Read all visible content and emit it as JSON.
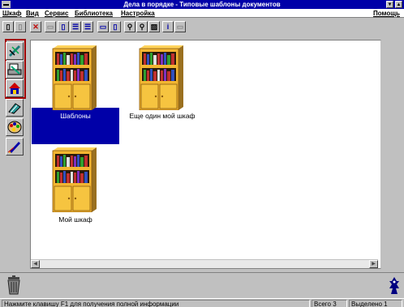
{
  "window": {
    "title": "Дела в порядке - Типовые шаблоны документов",
    "min_glyph": "▼",
    "max_glyph": "▲"
  },
  "menu": {
    "items": [
      {
        "label": "Шкаф"
      },
      {
        "label": "Вид"
      },
      {
        "label": "Сервис"
      },
      {
        "label": "Библиотека"
      },
      {
        "label": "Настройка"
      }
    ],
    "help": "Помощь"
  },
  "toolbar": {
    "buttons": [
      {
        "icon": "new-doc-icon",
        "glyph": "▯"
      },
      {
        "icon": "copy-doc-icon",
        "glyph": "▯",
        "disabled": true
      },
      {
        "icon": "delete-icon",
        "glyph": "✕"
      },
      {
        "icon": "cut-icon",
        "glyph": "▭",
        "disabled": true
      },
      {
        "icon": "folder-view-icon",
        "glyph": "▯"
      },
      {
        "icon": "tree-view-icon",
        "glyph": "☰"
      },
      {
        "icon": "list-view-icon",
        "glyph": "☰"
      },
      {
        "icon": "window-icon",
        "glyph": "▭"
      },
      {
        "icon": "split-window-icon",
        "glyph": "▯"
      },
      {
        "icon": "binoculars-icon",
        "glyph": "⚲"
      },
      {
        "icon": "magnifier-icon",
        "glyph": "⚲"
      },
      {
        "icon": "image-icon",
        "glyph": "▨"
      },
      {
        "icon": "info-icon",
        "glyph": "i"
      },
      {
        "icon": "keyboard-icon",
        "glyph": "▭",
        "disabled": true
      }
    ]
  },
  "cabinets": [
    {
      "label": "Шаблоны",
      "selected": true
    },
    {
      "label": "Еще один мой шкаф",
      "selected": false
    },
    {
      "label": "Мой шкаф",
      "selected": false
    }
  ],
  "colors": {
    "title_bar": "#0000a8",
    "selection": "#0000a8",
    "cabinet_wood": "#f2b531",
    "cabinet_top": "#b02020"
  },
  "status": {
    "hint": "Нажмите клавишу F1 для получения полной информации",
    "total": "Всего 3",
    "selected": "Выделено 1"
  }
}
